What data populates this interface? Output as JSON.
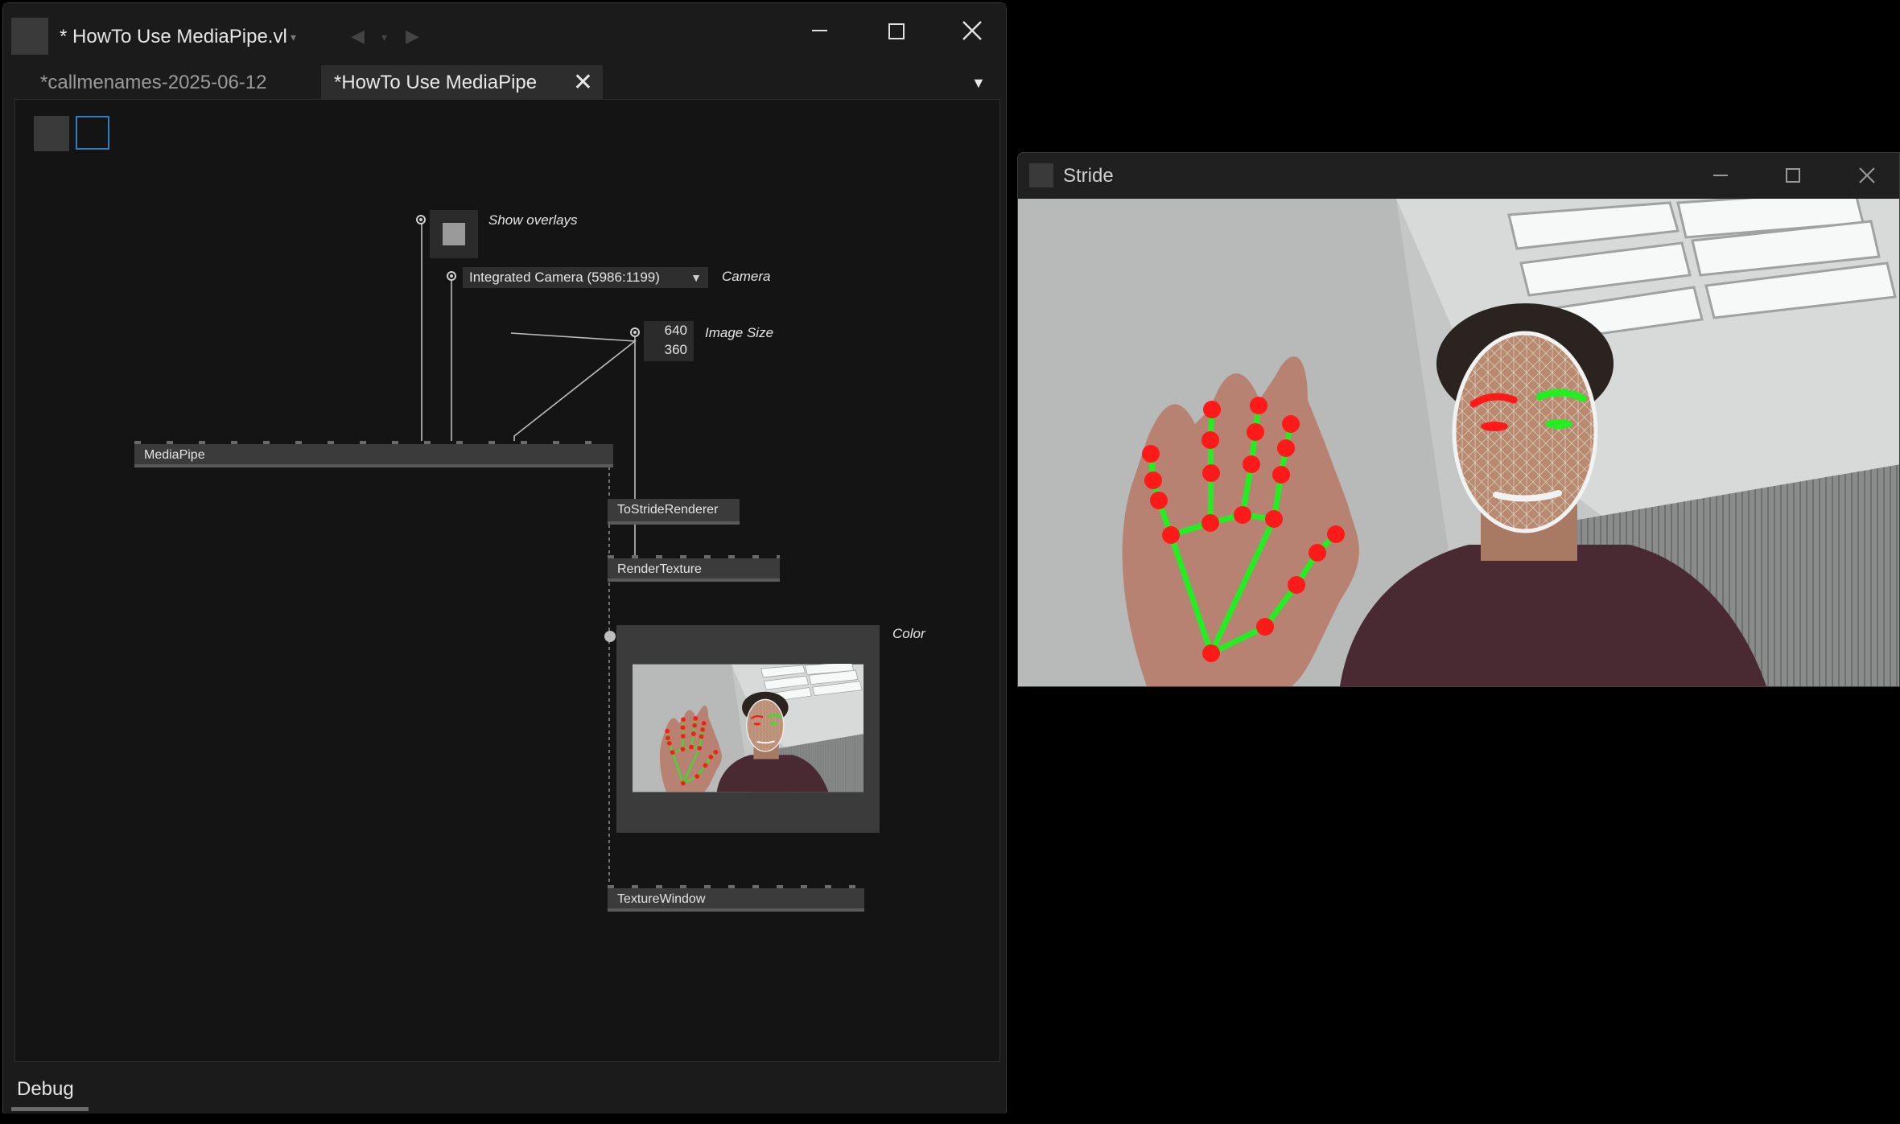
{
  "vl_window": {
    "title": "* HowTo Use MediaPipe.vl",
    "tabs": [
      {
        "label": "*callmenames-2025-06-12",
        "active": false
      },
      {
        "label": "*HowTo Use MediaPipe",
        "active": true
      }
    ],
    "status_tab": "Debug"
  },
  "patch": {
    "show_overlays_label": "Show overlays",
    "camera_value": "Integrated Camera (5986:1199)",
    "camera_label": "Camera",
    "image_size_values": [
      "640",
      "360"
    ],
    "image_size_label": "Image Size",
    "color_label": "Color",
    "nodes": {
      "mediapipe": "MediaPipe",
      "to_stride_renderer": "ToStrideRenderer",
      "render_texture": "RenderTexture",
      "texture_window": "TextureWindow"
    }
  },
  "stride_window": {
    "title": "Stride"
  },
  "colors": {
    "landmark_red": "#ff1a1a",
    "landmark_green": "#22ee22",
    "mesh_white": "#f2f2f2",
    "node_grey": "#3b3b3b"
  },
  "icons": [
    "minimize-icon",
    "maximize-icon",
    "close-icon",
    "chevron-down-icon",
    "back-arrow-icon",
    "forward-arrow-icon",
    "tab-close-icon",
    "tab-menu-icon"
  ]
}
